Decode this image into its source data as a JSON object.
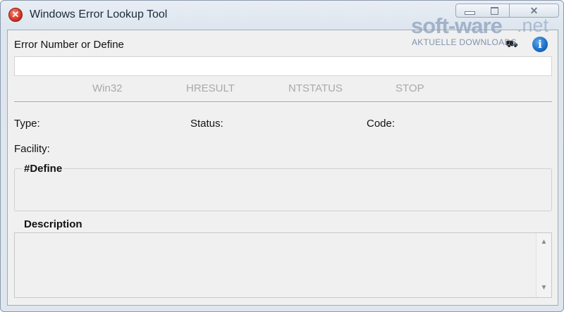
{
  "window": {
    "title": "Windows Error Lookup Tool",
    "app_icon_glyph": "✕",
    "close_glyph": "✕"
  },
  "form": {
    "error_label": "Error Number or Define",
    "error_value": "",
    "error_placeholder": "",
    "radios": [
      "Win32",
      "HRESULT",
      "NTSTATUS",
      "STOP"
    ],
    "type_label": "Type:",
    "status_label": "Status:",
    "code_label": "Code:",
    "facility_label": "Facility:",
    "define_title": "#Define",
    "description_title": "Description",
    "info_glyph": "i",
    "tool_glyph": "⛟"
  },
  "scrollbar": {
    "up_glyph": "▲",
    "down_glyph": "▼"
  },
  "watermark": {
    "main": "soft-ware",
    "tld": ".net",
    "tagline": "AKTUELLE DOWNLOADS"
  },
  "icons": {
    "app": "error-icon",
    "info": "info-icon",
    "tool": "toolbar-icon"
  },
  "colors": {
    "client_bg": "#f0f0f0",
    "disabled_text": "#a9a9a9",
    "info_blue": "#1a6cc4",
    "error_red": "#d93a2b"
  }
}
